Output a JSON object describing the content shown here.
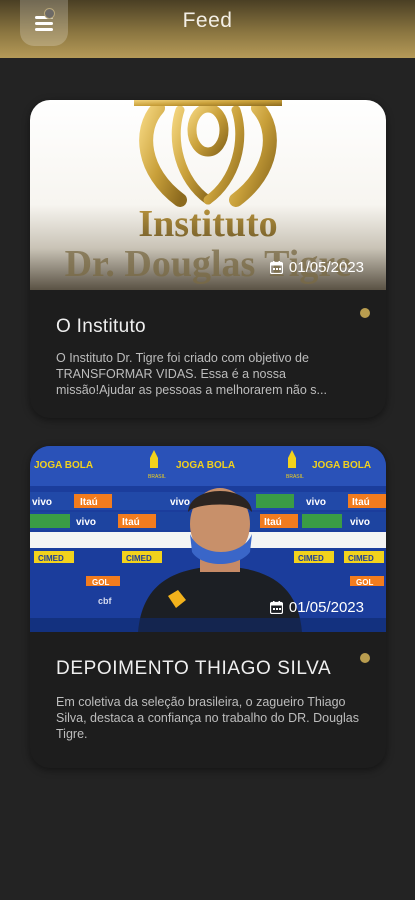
{
  "header": {
    "title": "Feed",
    "menu_icon": "hamburger-menu-icon",
    "accent_color": "#b99d4f"
  },
  "feed": [
    {
      "title": "O Instituto",
      "date": "01/05/2023",
      "description": "O Instituto Dr. Tigre foi criado com objetivo de TRANSFORMAR VIDAS. Essa é a nossa missão!Ajudar as pessoas a melhorarem não s...",
      "image": {
        "line1": "Instituto",
        "line2": "Dr. Douglas Tigre"
      }
    },
    {
      "title": "DEPOIMENTO THIAGO SILVA",
      "date": "01/05/2023",
      "description": "Em coletiva da seleção brasileira, o zagueiro Thiago Silva, destaca a confiança no trabalho do DR. Douglas Tigre.",
      "image": {
        "banner_text": "JOGA BOLA",
        "sponsor_itau": "Itaú",
        "sponsor_vivo": "vivo",
        "sponsor_cimed": "CIMED",
        "sponsor_gol": "GOL",
        "sponsor_cbf": "cbf",
        "brasil_label": "BRASIL"
      }
    }
  ]
}
